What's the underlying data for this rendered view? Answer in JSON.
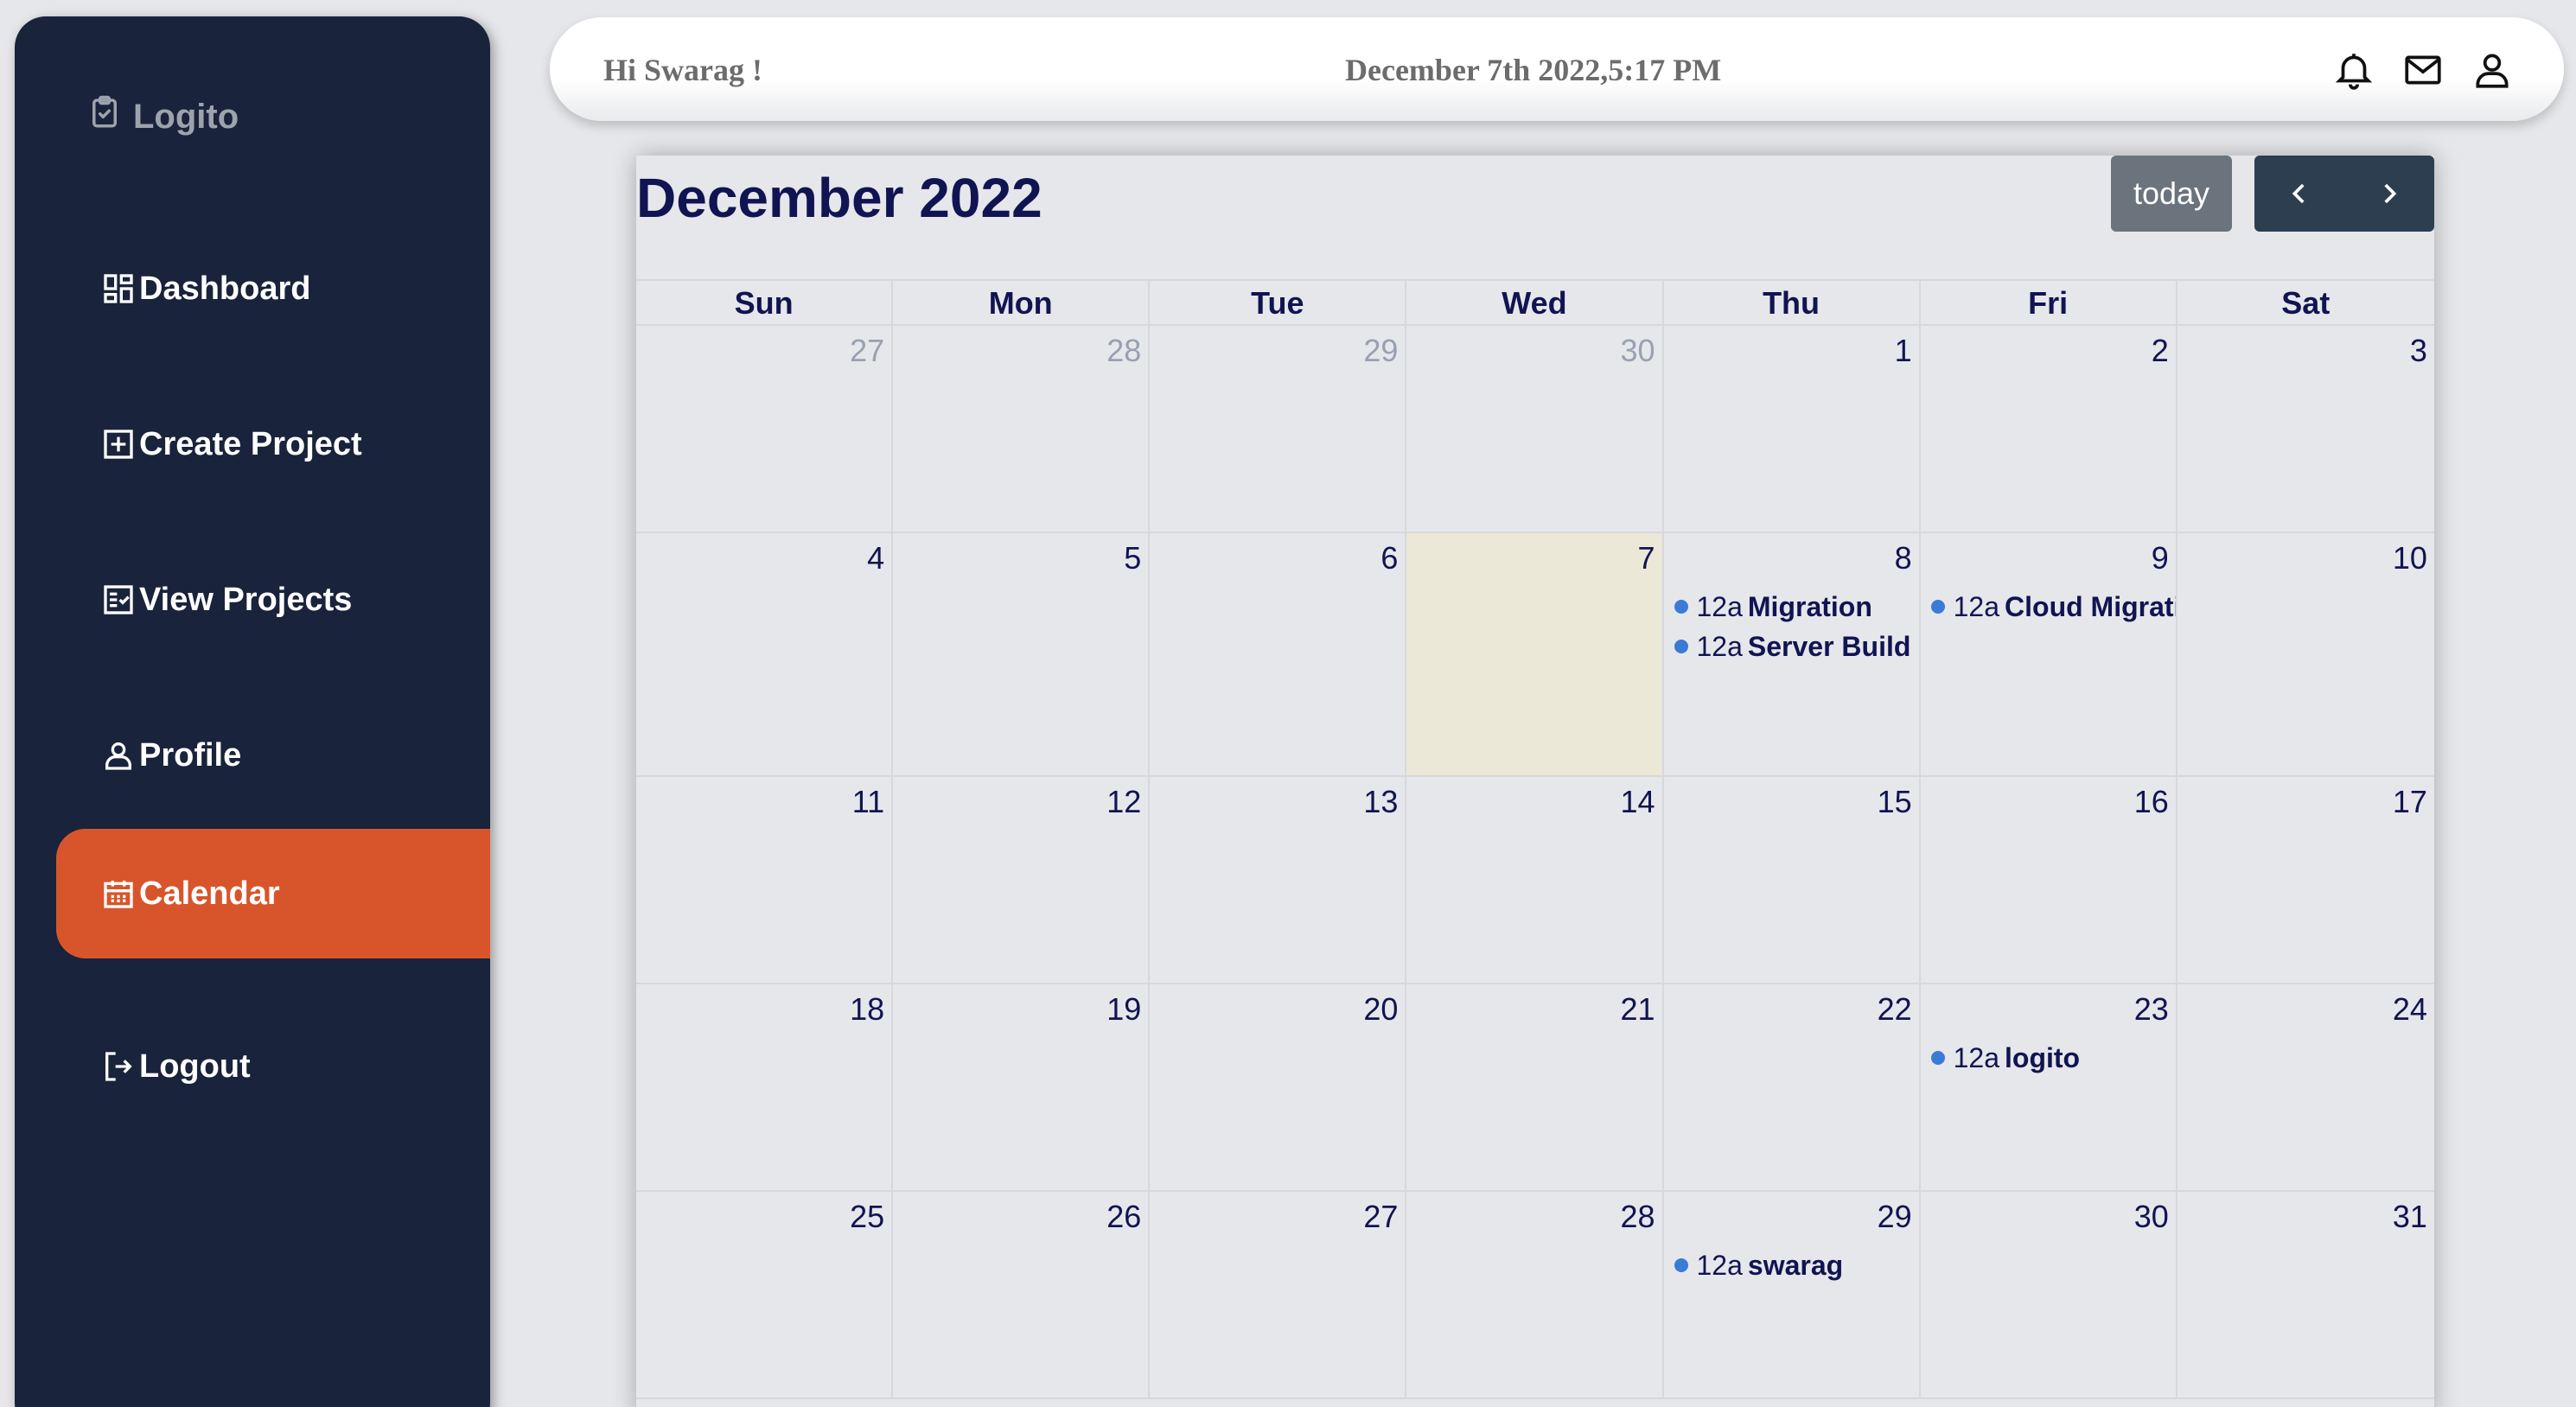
{
  "app": {
    "name": "Logito"
  },
  "sidebar": {
    "items": [
      {
        "label": "Dashboard",
        "icon": "dashboard-icon"
      },
      {
        "label": "Create Project",
        "icon": "plus-square-icon"
      },
      {
        "label": "View Projects",
        "icon": "checklist-icon"
      },
      {
        "label": "Profile",
        "icon": "user-icon"
      },
      {
        "label": "Calendar",
        "icon": "calendar-icon",
        "active": true
      },
      {
        "label": "Logout",
        "icon": "logout-icon"
      }
    ]
  },
  "header": {
    "greeting": "Hi Swarag !",
    "datetime": "December 7th 2022,5:17 PM",
    "icons": [
      "bell-icon",
      "mail-icon",
      "user-icon"
    ]
  },
  "calendar": {
    "title": "December 2022",
    "today_label": "today",
    "weekdays": [
      "Sun",
      "Mon",
      "Tue",
      "Wed",
      "Thu",
      "Fri",
      "Sat"
    ],
    "weeks": [
      [
        {
          "d": "27",
          "other": true
        },
        {
          "d": "28",
          "other": true
        },
        {
          "d": "29",
          "other": true
        },
        {
          "d": "30",
          "other": true
        },
        {
          "d": "1"
        },
        {
          "d": "2"
        },
        {
          "d": "3"
        }
      ],
      [
        {
          "d": "4"
        },
        {
          "d": "5"
        },
        {
          "d": "6"
        },
        {
          "d": "7",
          "today": true
        },
        {
          "d": "8",
          "events": [
            {
              "time": "12a",
              "title": "Migration"
            },
            {
              "time": "12a",
              "title": "Server Build"
            }
          ]
        },
        {
          "d": "9",
          "events": [
            {
              "time": "12a",
              "title": "Cloud Migration"
            }
          ]
        },
        {
          "d": "10"
        }
      ],
      [
        {
          "d": "11"
        },
        {
          "d": "12"
        },
        {
          "d": "13"
        },
        {
          "d": "14"
        },
        {
          "d": "15"
        },
        {
          "d": "16"
        },
        {
          "d": "17"
        }
      ],
      [
        {
          "d": "18"
        },
        {
          "d": "19"
        },
        {
          "d": "20"
        },
        {
          "d": "21"
        },
        {
          "d": "22"
        },
        {
          "d": "23",
          "events": [
            {
              "time": "12a",
              "title": "logito"
            }
          ]
        },
        {
          "d": "24"
        }
      ],
      [
        {
          "d": "25"
        },
        {
          "d": "26"
        },
        {
          "d": "27"
        },
        {
          "d": "28"
        },
        {
          "d": "29",
          "events": [
            {
              "time": "12a",
              "title": "swarag"
            }
          ]
        },
        {
          "d": "30"
        },
        {
          "d": "31"
        }
      ]
    ]
  },
  "colors": {
    "sidebar_bg": "#19233b",
    "accent": "#d8552b",
    "calendar_text": "#111452",
    "event_dot": "#3a7bd5",
    "today_bg": "#ebe8d8"
  }
}
